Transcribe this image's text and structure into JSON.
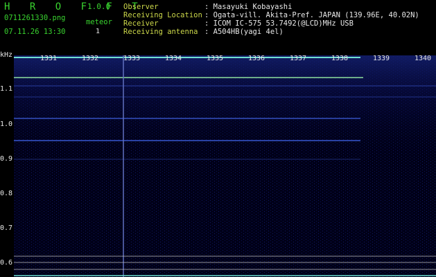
{
  "app": {
    "title": "H R O F F T",
    "version": "1.0.0"
  },
  "file": {
    "name": "0711261330.png",
    "datetime": "07.11.26 13:30"
  },
  "meteor": {
    "label": "meteor",
    "count": "1"
  },
  "station": [
    {
      "label": "Observer",
      "value": ": Masayuki Kobayashi"
    },
    {
      "label": "Receiving Location",
      "value": ": Ogata-vill. Akita-Pref. JAPAN (139.96E, 40.02N)"
    },
    {
      "label": "Receiver",
      "value": ": ICOM IC-575 53.7492(@LCD)MHz USB"
    },
    {
      "label": "Receiving antenna",
      "value": ": A504HB(yagi 4el)"
    }
  ],
  "axis": {
    "y_unit": "kHz",
    "y_labels": [
      "1.1",
      "1.0",
      "0.9",
      "0.8",
      "0.7",
      "0.6"
    ],
    "x_labels": [
      "1331",
      "1332",
      "1333",
      "1334",
      "1335",
      "1336",
      "1337",
      "1338",
      "1339",
      "1340"
    ]
  },
  "colors": {
    "label_green": "#39d32f",
    "label_yellow": "#ccd84a",
    "trace": "#6ee0d0"
  }
}
